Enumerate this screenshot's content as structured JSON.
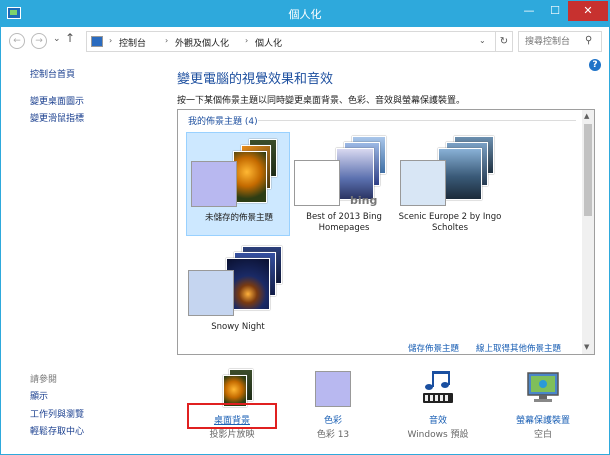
{
  "window": {
    "title": "個人化",
    "min": "—",
    "max": "☐",
    "close": "✕"
  },
  "nav": {
    "back": "←",
    "forward": "→",
    "recent": "⌄",
    "up": "↑",
    "crumbs": [
      "控制台",
      "外觀及個人化",
      "個人化"
    ],
    "crumb_sep": "›",
    "addr_dropdown": "⌄",
    "refresh": "↻",
    "search_placeholder": "搜尋控制台",
    "search_icon": "⚲"
  },
  "help": "?",
  "sidebar": {
    "links": [
      "控制台首頁",
      "變更桌面圖示",
      "變更滑鼠指標"
    ],
    "see_also_title": "請參閱",
    "see_also": [
      "顯示",
      "工作列與瀏覽",
      "輕鬆存取中心"
    ]
  },
  "main": {
    "title": "變更電腦的視覺效果和音效",
    "description": "按一下某個佈景主題以同時變更桌面背景、色彩、音效與螢幕保護裝置。",
    "my_themes_header": "我的佈景主題 (4)",
    "themes": [
      {
        "label": "未儲存的佈景主題",
        "selected": true
      },
      {
        "label": "Best of 2013 Bing Homepages",
        "brand": "bing"
      },
      {
        "label": "Scenic Europe 2 by Ingo Scholtes"
      },
      {
        "label": "Snowy Night"
      }
    ],
    "save_theme_link": "儲存佈景主題",
    "get_more_link": "線上取得其他佈景主題"
  },
  "bottom": [
    {
      "label": "桌面背景",
      "sub": "投影片放映"
    },
    {
      "label": "色彩",
      "sub": "色彩 13"
    },
    {
      "label": "音效",
      "sub": "Windows 預設"
    },
    {
      "label": "螢幕保護裝置",
      "sub": "空白"
    }
  ],
  "colors": {
    "titlebar": "#2ea9dc",
    "link": "#1a5fb4",
    "selected": "#cde8ff",
    "highlight": "#e02020"
  }
}
